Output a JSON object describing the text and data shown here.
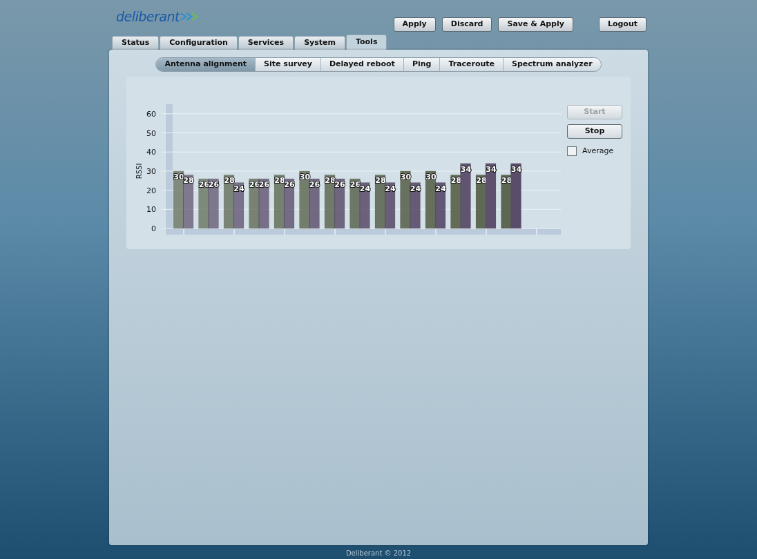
{
  "logo": {
    "text": "deliberant"
  },
  "header_buttons": [
    {
      "label": "Apply"
    },
    {
      "label": "Discard"
    },
    {
      "label": "Save & Apply"
    },
    {
      "label": "Logout",
      "kind": "logout"
    }
  ],
  "tabs": [
    {
      "label": "Status",
      "selected": false
    },
    {
      "label": "Configuration",
      "selected": false
    },
    {
      "label": "Services",
      "selected": false
    },
    {
      "label": "System",
      "selected": false
    },
    {
      "label": "Tools",
      "selected": true
    }
  ],
  "subtabs": [
    {
      "label": "Antenna alignment",
      "selected": true
    },
    {
      "label": "Site survey",
      "selected": false
    },
    {
      "label": "Delayed reboot",
      "selected": false
    },
    {
      "label": "Ping",
      "selected": false
    },
    {
      "label": "Traceroute",
      "selected": false
    },
    {
      "label": "Spectrum analyzer",
      "selected": false
    }
  ],
  "chart": {
    "chart_data": {
      "type": "bar",
      "ylabel": "RSSI",
      "grid": true,
      "ylim": [
        0,
        65
      ],
      "yticks": [
        0,
        10,
        20,
        30,
        40,
        50,
        60
      ],
      "data_labels": true,
      "series": [
        {
          "color": "#5c6650",
          "values": [
            30,
            26,
            28,
            26,
            28,
            30,
            28,
            26,
            28,
            30,
            30,
            28,
            28,
            28
          ]
        },
        {
          "color": "#5a4d6a",
          "values": [
            28,
            26,
            24,
            26,
            26,
            26,
            26,
            24,
            24,
            24,
            24,
            34,
            34,
            34
          ]
        }
      ]
    }
  },
  "controls": {
    "buttons": [
      {
        "label": "Start",
        "disabled": true
      },
      {
        "label": "Stop",
        "disabled": false
      }
    ],
    "average": {
      "label": "Average",
      "checked": false
    }
  },
  "footer": "Deliberant © 2012"
}
